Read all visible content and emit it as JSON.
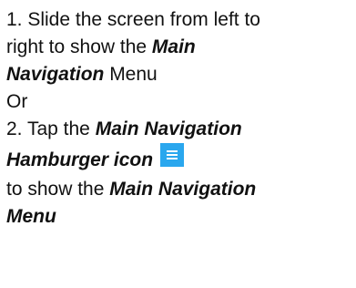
{
  "step1": {
    "prefix": "1.  Slide the screen from left to",
    "line2_text": "right to show the ",
    "line2_emph": "Main",
    "line3_emph": "Navigation",
    "line3_text": " Menu"
  },
  "separator": "Or",
  "step2": {
    "prefix": "2.  Tap the ",
    "emph1": "Main Navigation",
    "emph2": "Hamburger icon",
    "icon": "hamburger-menu-icon",
    "icon_color": "#2AA7EE",
    "line3_text": "to show the ",
    "line3_emph": "Main Navigation",
    "line4_emph": "Menu"
  }
}
